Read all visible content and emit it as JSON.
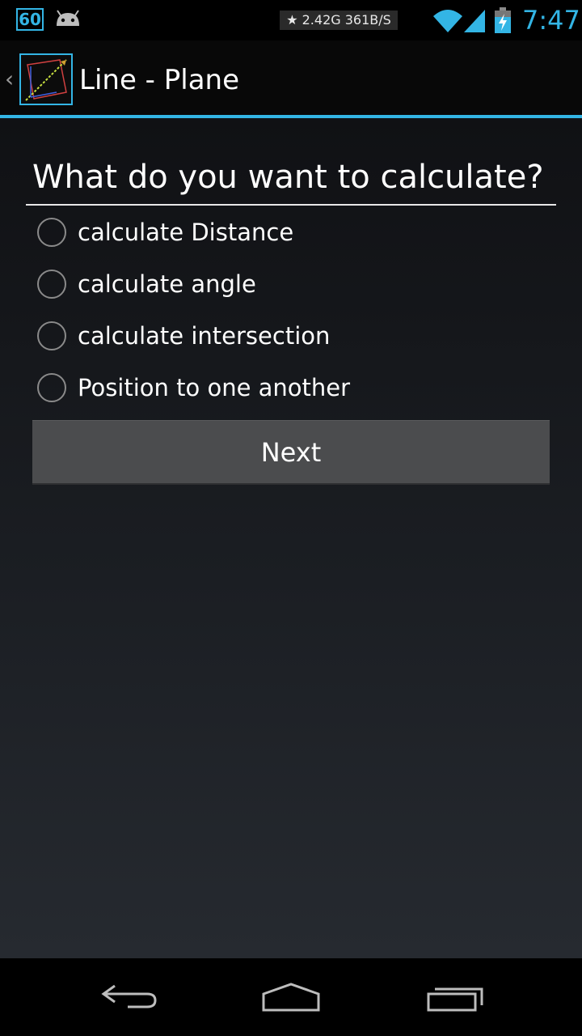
{
  "status_bar": {
    "badge": "60",
    "network_speed": "★ 2.42G  361B/S",
    "time": "7:47",
    "accent_color": "#33b5e5",
    "icons": [
      "android-icon",
      "wifi-icon",
      "signal-icon",
      "battery-charging-icon"
    ]
  },
  "action_bar": {
    "title": "Line - Plane",
    "app_icon": "line-plane-app-icon",
    "up_icon": "chevron-left-icon"
  },
  "main": {
    "question": "What do you want to calculate?",
    "options": [
      {
        "label": "calculate Distance",
        "selected": false
      },
      {
        "label": "calculate angle",
        "selected": false
      },
      {
        "label": "calculate intersection",
        "selected": false
      },
      {
        "label": "Position to one another",
        "selected": false
      }
    ],
    "next_label": "Next"
  },
  "nav_bar": {
    "buttons": [
      "back-icon",
      "home-icon",
      "recent-apps-icon"
    ]
  }
}
